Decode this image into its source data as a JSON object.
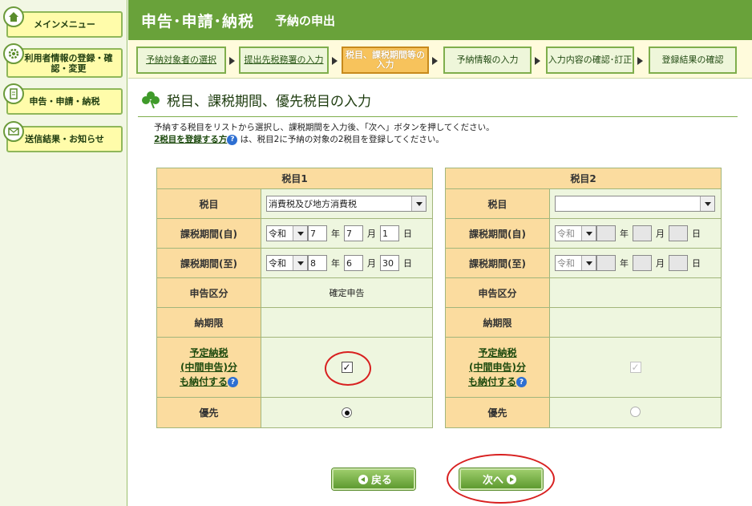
{
  "sidebar": {
    "items": [
      {
        "label": "メインメニュー",
        "icon": "home-icon"
      },
      {
        "label": "利用者情報の登録・確認・変更",
        "icon": "gear-icon"
      },
      {
        "label": "申告・申請・納税",
        "icon": "document-icon"
      },
      {
        "label": "送信結果・お知らせ",
        "icon": "mail-icon"
      }
    ]
  },
  "header": {
    "title": "申告･申請･納税",
    "subtitle": "予納の申出"
  },
  "steps": [
    {
      "label": "予納対象者の選択",
      "state": "done"
    },
    {
      "label": "提出先税務署の入力",
      "state": "done"
    },
    {
      "label": "税目、課税期間等の入力",
      "state": "current"
    },
    {
      "label": "予納情報の入力",
      "state": "pending"
    },
    {
      "label": "入力内容の確認･訂正",
      "state": "pending"
    },
    {
      "label": "登録結果の確認",
      "state": "pending"
    }
  ],
  "section": {
    "title": "税目、課税期間、優先税目の入力",
    "instruction1": "予納する税目をリストから選択し、課税期間を入力後、「次へ」ボタンを押してください。",
    "link_text": "2税目を登録する方",
    "instruction2": "は、税目2に予納の対象の2税目を登録してください。"
  },
  "labels": {
    "tax_item": "税目",
    "period_from": "課税期間(自)",
    "period_to": "課税期間(至)",
    "declaration_type": "申告区分",
    "deadline": "納期限",
    "scheduled_line1": "予定納税",
    "scheduled_line2": "(中間申告)分",
    "scheduled_line3": "も納付する",
    "priority": "優先",
    "year": "年",
    "month": "月",
    "day": "日"
  },
  "table1": {
    "header": "税目1",
    "tax_item": "消費税及び地方消費税",
    "from": {
      "era": "令和",
      "year": "7",
      "month": "7",
      "day": "1"
    },
    "to": {
      "era": "令和",
      "year": "8",
      "month": "6",
      "day": "30"
    },
    "declaration_type": "確定申告",
    "deadline": "",
    "scheduled_checked": true,
    "priority_selected": true
  },
  "table2": {
    "header": "税目2",
    "tax_item": "",
    "from": {
      "era": "令和",
      "year": "",
      "month": "",
      "day": ""
    },
    "to": {
      "era": "令和",
      "year": "",
      "month": "",
      "day": ""
    },
    "declaration_type": "",
    "deadline": "",
    "scheduled_checked": true,
    "scheduled_disabled": true,
    "priority_selected": false
  },
  "buttons": {
    "back": "戻る",
    "next": "次へ"
  },
  "colors": {
    "header_green": "#69a23a",
    "current_step": "#f7c35c",
    "table_label": "#fbdc9f",
    "highlight_red": "#d82020"
  }
}
